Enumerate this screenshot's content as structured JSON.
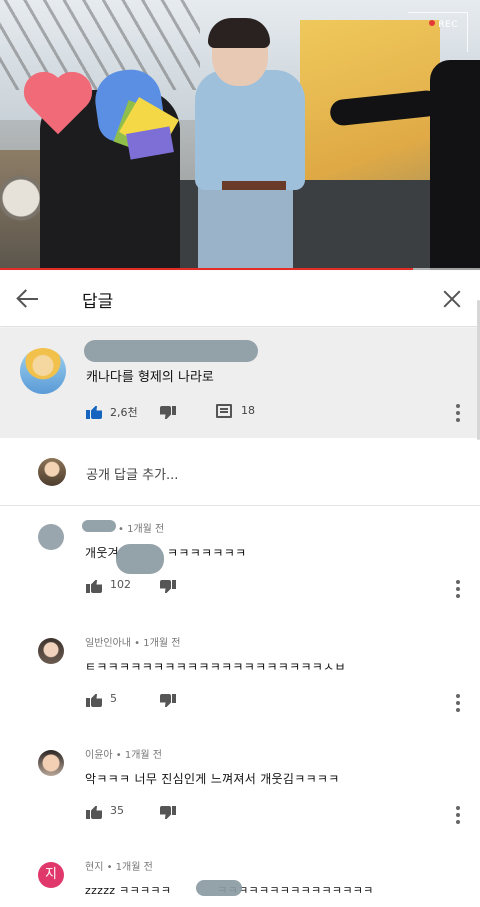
{
  "video": {
    "rec_label": "REC",
    "progress_fraction": 0.86
  },
  "header": {
    "back_icon": "arrow-left-icon",
    "title": "답글",
    "close_icon": "close-icon"
  },
  "original_comment": {
    "author": "",
    "text": "캐나다를 형제의 나라로",
    "likes": "2,6천",
    "replies": "18",
    "like_color": "#1565c0"
  },
  "add_reply": {
    "placeholder": "공개 답글 추가..."
  },
  "replies": [
    {
      "author": "• 1개월 전",
      "text": "개웃겨",
      "text_tail": "ㅋㅋㅋㅋㅋㅋㅋ",
      "likes": "102"
    },
    {
      "author": "일반인아내 • 1개월 전",
      "text": "ㅌㅋㅋㅋㅋㅋㅋㅋㅋㅋㅋㅋㅋㅋㅋㅋㅋㅋㅋㅋㅋㅅㅂ",
      "likes": "5"
    },
    {
      "author": "이윤아 • 1개월 전",
      "text": "악ㅋㅋㅋ 너무 진심인게 느껴져서 개웃김ㅋㅋㅋㅋ",
      "likes": "35"
    },
    {
      "author": "현지 • 1개월 전",
      "avatar_letter": "지",
      "text": "zzzzz ㅋㅋㅋㅋㅋ",
      "text_tail": "ㅋㅋㅋㅋㅋㅋㅋㅋㅋㅋㅋㅋㅋㅋㅋ",
      "likes": ""
    }
  ]
}
